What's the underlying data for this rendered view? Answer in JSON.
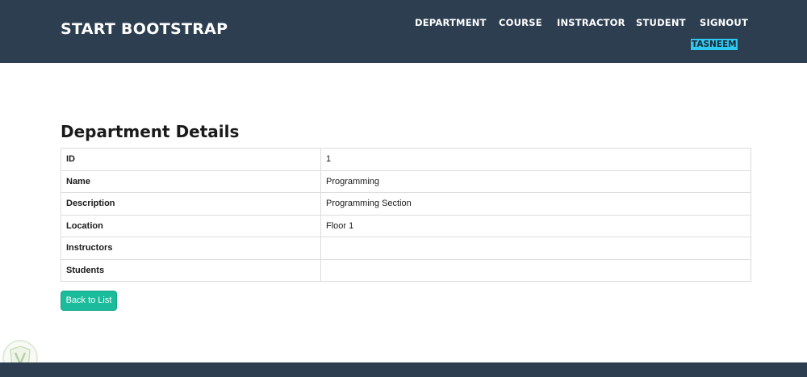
{
  "navbar": {
    "brand": "START BOOTSTRAP",
    "links": [
      "DEPARTMENT",
      "COURSE",
      "INSTRACTOR",
      "STUDENT",
      "SIGNOUT"
    ],
    "user": "TASNEEM",
    "background_color": "#2c3e50",
    "user_badge_color": "#2ec8f0"
  },
  "main": {
    "title": "Department Details",
    "rows": [
      {
        "label": "ID",
        "value": "1"
      },
      {
        "label": "Name",
        "value": "Programming"
      },
      {
        "label": "Description",
        "value": "Programming Section"
      },
      {
        "label": "Location",
        "value": "Floor 1"
      },
      {
        "label": "Instructors",
        "value": ""
      },
      {
        "label": "Students",
        "value": ""
      }
    ],
    "back_button": "Back to List",
    "button_color": "#1abc9c"
  },
  "icons": {
    "watermark": "shield-logo-icon"
  }
}
